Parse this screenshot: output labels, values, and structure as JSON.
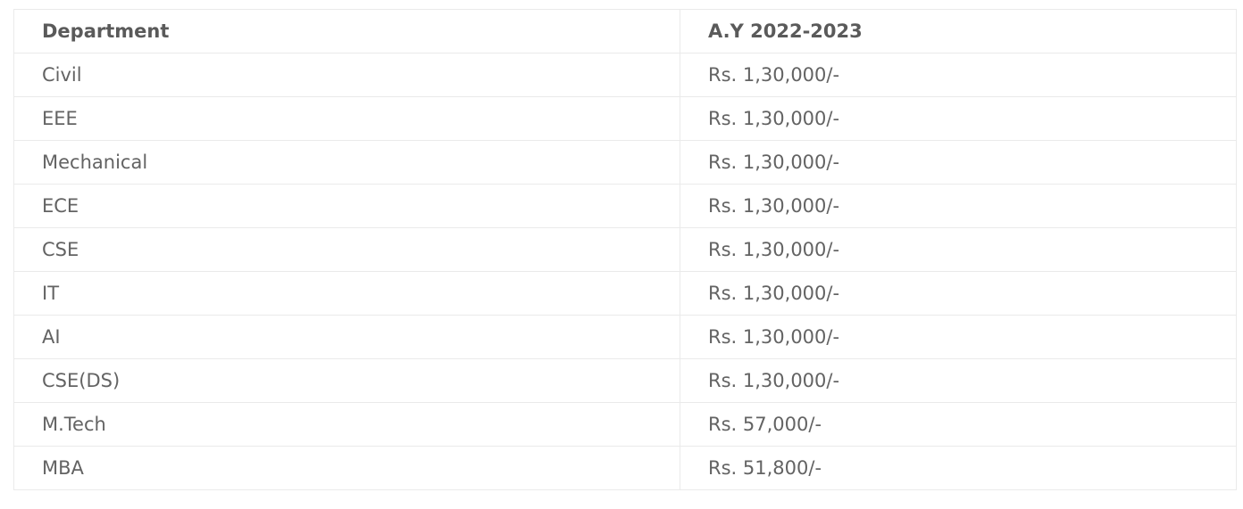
{
  "table": {
    "headers": {
      "department": "Department",
      "year": "A.Y 2022-2023"
    },
    "rows": [
      {
        "department": "Civil",
        "fee": "Rs. 1,30,000/-"
      },
      {
        "department": "EEE",
        "fee": "Rs. 1,30,000/-"
      },
      {
        "department": "Mechanical",
        "fee": "Rs. 1,30,000/-"
      },
      {
        "department": "ECE",
        "fee": "Rs. 1,30,000/-"
      },
      {
        "department": "CSE",
        "fee": "Rs. 1,30,000/-"
      },
      {
        "department": "IT",
        "fee": "Rs. 1,30,000/-"
      },
      {
        "department": "AI",
        "fee": "Rs. 1,30,000/-"
      },
      {
        "department": "CSE(DS)",
        "fee": "Rs. 1,30,000/-"
      },
      {
        "department": "M.Tech",
        "fee": "Rs. 57,000/-"
      },
      {
        "department": "MBA",
        "fee": "Rs. 51,800/-"
      }
    ]
  },
  "colors": {
    "text": "#636363",
    "header_text": "#5a5a5a",
    "border": "#eaeaea",
    "background": "#ffffff"
  }
}
